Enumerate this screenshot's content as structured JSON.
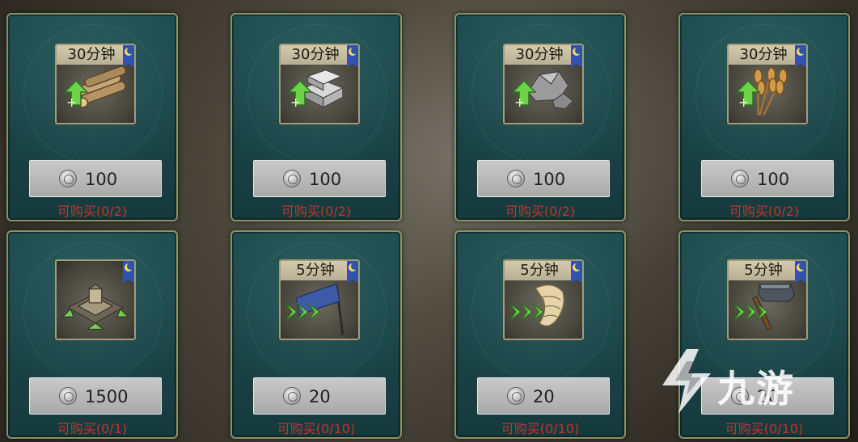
{
  "shop": {
    "items": [
      {
        "name": "wood-speedup",
        "time": "30分钟",
        "price": "100",
        "limit": "可购买(0/2)",
        "icon": "wood-logs-icon"
      },
      {
        "name": "iron-speedup",
        "time": "30分钟",
        "price": "100",
        "limit": "可购买(0/2)",
        "icon": "iron-ingot-icon"
      },
      {
        "name": "stone-speedup",
        "time": "30分钟",
        "price": "100",
        "limit": "可购买(0/2)",
        "icon": "stone-icon"
      },
      {
        "name": "grain-speedup",
        "time": "30分钟",
        "price": "100",
        "limit": "可购买(0/2)",
        "icon": "wheat-icon"
      },
      {
        "name": "fortress-speedup",
        "time": "",
        "price": "1500",
        "limit": "可购买(0/1)",
        "icon": "fortress-icon"
      },
      {
        "name": "march-speedup",
        "time": "5分钟",
        "price": "20",
        "limit": "可购买(0/10)",
        "icon": "banner-icon"
      },
      {
        "name": "recruit-speedup",
        "time": "5分钟",
        "price": "20",
        "limit": "可购买(0/10)",
        "icon": "scroll-icon"
      },
      {
        "name": "build-speedup",
        "time": "5分钟",
        "price": "20",
        "limit": "可购买(0/10)",
        "icon": "hammer-icon"
      }
    ]
  },
  "watermark": {
    "text": "九游"
  },
  "colors": {
    "card": "#1a4346",
    "limit_text": "#c8322b",
    "ribbon": "#2f52b5",
    "boost_arrow": "#6fd04a"
  }
}
